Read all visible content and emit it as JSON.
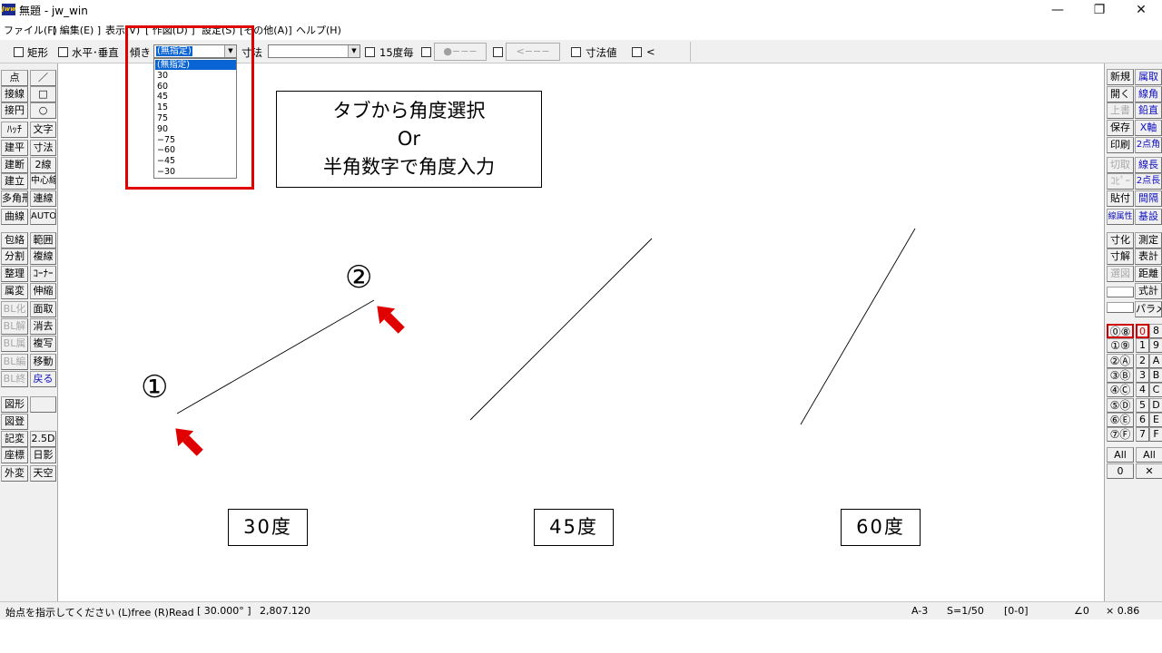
{
  "window": {
    "title": "無題 - jw_win",
    "app_icon": "jw-app-icon",
    "icon_text": "Jww",
    "controls": {
      "minimize": "—",
      "maximize": "❐",
      "close": "✕"
    }
  },
  "menu": [
    "ファイル(F)",
    "[ 編集(E) ]",
    "表示(V)",
    "[ 作図(D) ]",
    "設定(S)",
    "[その他(A)]",
    "ヘルプ(H)"
  ],
  "toolbar": {
    "rect_label": "矩形",
    "hv_label": "水平･垂直",
    "tilt_label": "傾き",
    "tilt_value": "(無指定)",
    "dim_label": "寸法",
    "dim_value": "",
    "deg15_label": "15度毎",
    "btn_dot": "●−−−",
    "btn_arrow": "<−−−",
    "dimval_label": "寸法値",
    "lt_label": "<"
  },
  "dropdown": {
    "options": [
      "(無指定)",
      "30",
      "60",
      "45",
      "15",
      "75",
      "90",
      "−75",
      "−60",
      "−45",
      "−30"
    ],
    "selected_index": 0
  },
  "left_palette": {
    "col1": [
      "点",
      "接線",
      "接円",
      "ﾊｯﾁ",
      "建平",
      "建断",
      "建立",
      "多角形",
      "曲線",
      "包絡",
      "分割",
      "整理",
      "属変",
      "BL化",
      "BL解",
      "BL属",
      "BL編",
      "BL終",
      "図形",
      "図登",
      "記変",
      "座標",
      "外変"
    ],
    "col2": [
      "／",
      "□",
      "○",
      "文字",
      "寸法",
      "2線",
      "中心線",
      "連線",
      "AUTO",
      "範囲",
      "複線",
      "ｺｰﾅｰ",
      "伸縮",
      "面取",
      "消去",
      "複写",
      "移動",
      "戻る",
      "",
      "2.5D",
      "日影",
      "天空"
    ]
  },
  "right_palette": {
    "col1": [
      "新規",
      "開く",
      "上書",
      "保存",
      "印刷",
      "切取",
      "ｺﾋﾟｰ",
      "貼付",
      "線属性",
      "寸化",
      "寸解",
      "選図"
    ],
    "col2": [
      "属取",
      "線角",
      "鉛直",
      "X軸",
      "2点角",
      "線長",
      "2点長",
      "間隔",
      "基設",
      "測定",
      "表計",
      "距離",
      "",
      "式計",
      "パラメ"
    ],
    "layer_groups_left": [
      "⓪⑧",
      "①⑨",
      "②Ⓐ",
      "③Ⓑ",
      "④Ⓒ",
      "⑤Ⓓ",
      "⑥Ⓔ",
      "⑦Ⓕ"
    ],
    "layers_right": [
      "0",
      "8",
      "1",
      "9",
      "2",
      "A",
      "3",
      "B",
      "4",
      "C",
      "5",
      "D",
      "6",
      "E",
      "7",
      "F"
    ],
    "all_left": "All",
    "zero_left": "0",
    "all_right": "All",
    "x_right": "✕"
  },
  "canvas": {
    "annotation": [
      "タブから角度選択",
      "Or",
      "半角数字で角度入力"
    ],
    "marker_1": "①",
    "marker_2": "②",
    "labels": [
      "30度",
      "45度",
      "60度"
    ]
  },
  "status": {
    "prompt": "始点を指示してください (L)free (R)Read",
    "angle": "[ 30.000° ]",
    "length": "2,807.120",
    "paper": "A-3",
    "scale": "S=1/50",
    "layer": "[0-0]",
    "angle_icon": "∠0",
    "zoom": "× 0.86"
  },
  "colors": {
    "highlight": "#0a64d4",
    "annotation_red": "#e00000",
    "button_face": "#f0f0f0"
  }
}
